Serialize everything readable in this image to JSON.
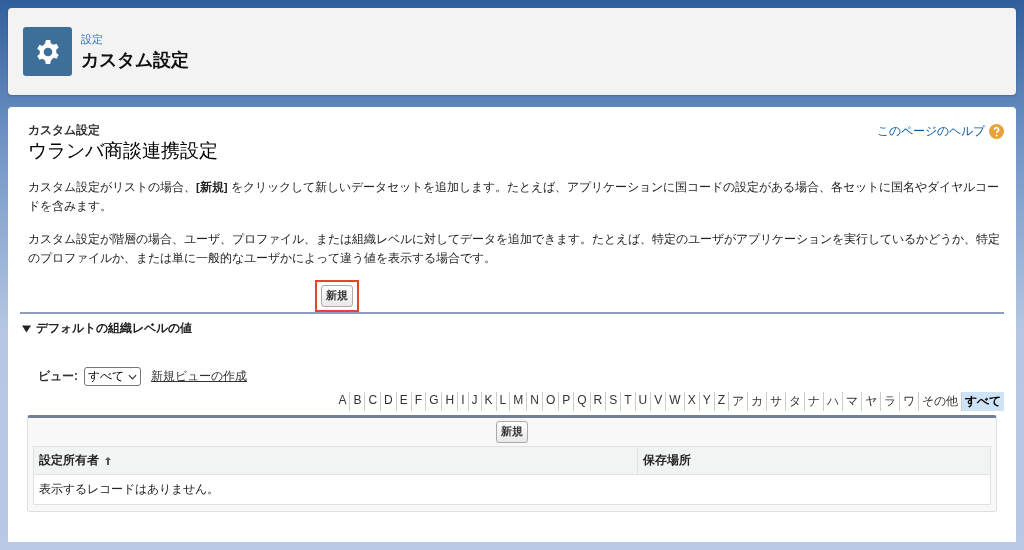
{
  "header": {
    "breadcrumb": "設定",
    "title": "カスタム設定"
  },
  "page": {
    "type_label": "カスタム設定",
    "title": "ウランバ商談連携設定",
    "help_link": "このページのヘルプ",
    "paragraphs": [
      "カスタム設定がリストの場合、**[新規]** をクリックして新しいデータセットを追加します。たとえば、アプリケーションに国コードの設定がある場合、各セットに国名やダイヤルコードを含みます。",
      "カスタム設定が階層の場合、ユーザ、プロファイル、または組織レベルに対してデータを追加できます。たとえば、特定のユーザがアプリケーションを実行しているかどうか、特定のプロファイルか、または単に一般的なユーザかによって違う値を表示する場合です。"
    ],
    "new_button": {
      "label": "新規",
      "highlighted": true
    }
  },
  "section": {
    "title": "デフォルトの組織レベルの値",
    "expanded": true,
    "view": {
      "label": "ビュー:",
      "value": "すべて",
      "create_link": "新規ビューの作成"
    },
    "letters": [
      {
        "label": "A",
        "selected": false
      },
      {
        "label": "B",
        "selected": false
      },
      {
        "label": "C",
        "selected": false
      },
      {
        "label": "D",
        "selected": false
      },
      {
        "label": "E",
        "selected": false
      },
      {
        "label": "F",
        "selected": false
      },
      {
        "label": "G",
        "selected": false
      },
      {
        "label": "H",
        "selected": false
      },
      {
        "label": "I",
        "selected": false
      },
      {
        "label": "J",
        "selected": false
      },
      {
        "label": "K",
        "selected": false
      },
      {
        "label": "L",
        "selected": false
      },
      {
        "label": "M",
        "selected": false
      },
      {
        "label": "N",
        "selected": false
      },
      {
        "label": "O",
        "selected": false
      },
      {
        "label": "P",
        "selected": false
      },
      {
        "label": "Q",
        "selected": false
      },
      {
        "label": "R",
        "selected": false
      },
      {
        "label": "S",
        "selected": false
      },
      {
        "label": "T",
        "selected": false
      },
      {
        "label": "U",
        "selected": false
      },
      {
        "label": "V",
        "selected": false
      },
      {
        "label": "W",
        "selected": false
      },
      {
        "label": "X",
        "selected": false
      },
      {
        "label": "Y",
        "selected": false
      },
      {
        "label": "Z",
        "selected": false
      },
      {
        "label": "ア",
        "selected": false
      },
      {
        "label": "カ",
        "selected": false
      },
      {
        "label": "サ",
        "selected": false
      },
      {
        "label": "タ",
        "selected": false
      },
      {
        "label": "ナ",
        "selected": false
      },
      {
        "label": "ハ",
        "selected": false
      },
      {
        "label": "マ",
        "selected": false
      },
      {
        "label": "ヤ",
        "selected": false
      },
      {
        "label": "ラ",
        "selected": false
      },
      {
        "label": "ワ",
        "selected": false
      },
      {
        "label": "その他",
        "selected": false
      },
      {
        "label": "すべて",
        "selected": true
      }
    ],
    "table": {
      "new_button": "新規",
      "columns": [
        {
          "label": "設定所有者",
          "sorted": true
        },
        {
          "label": "保存場所",
          "sorted": false
        }
      ],
      "empty_message": "表示するレコードはありません。"
    }
  }
}
